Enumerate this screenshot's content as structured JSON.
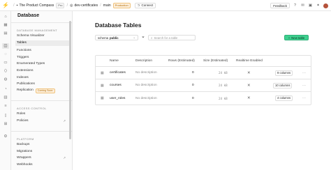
{
  "topbar": {
    "org": "The Product Compass",
    "org_badge": "Pro",
    "project": "dev-certificates",
    "branch": "main",
    "env_badge": "Production",
    "connect_label": "Connect",
    "feedback_label": "Feedback"
  },
  "sidebar": {
    "title": "Database",
    "sections": [
      {
        "label": "DATABASE MANAGEMENT",
        "items": [
          {
            "label": "Schema Visualizer"
          },
          {
            "label": "Tables"
          },
          {
            "label": "Functions"
          },
          {
            "label": "Triggers"
          },
          {
            "label": "Enumerated Types"
          },
          {
            "label": "Extensions"
          },
          {
            "label": "Indexes"
          },
          {
            "label": "Publications"
          },
          {
            "label": "Replication",
            "badge": "Coming Soon"
          }
        ]
      },
      {
        "label": "ACCESS CONTROL",
        "items": [
          {
            "label": "Roles"
          },
          {
            "label": "Policies"
          }
        ]
      },
      {
        "label": "PLATFORM",
        "items": [
          {
            "label": "Backups"
          },
          {
            "label": "Migrations"
          },
          {
            "label": "Wrappers"
          },
          {
            "label": "Webhooks"
          }
        ]
      }
    ]
  },
  "main": {
    "title": "Database Tables",
    "schema_prefix": "schema",
    "schema_value": "public",
    "search_placeholder": "Search for a table",
    "new_table_label": "New table",
    "columns": [
      "Name",
      "Description",
      "Rows (Estimated)",
      "Size (Estimated)",
      "Realtime Enabled"
    ],
    "rows": [
      {
        "name": "certificates",
        "description": "No description",
        "rows": "0",
        "size": "24 kB",
        "columns_label": "9 columns"
      },
      {
        "name": "courses",
        "description": "No description",
        "rows": "0",
        "size": "24 kB",
        "columns_label": "10 columns"
      },
      {
        "name": "user_roles",
        "description": "No description",
        "rows": "0",
        "size": "24 kB",
        "columns_label": "4 columns"
      }
    ]
  },
  "colors": {
    "brand": "#3ecf8e",
    "warning": "#b26b00"
  }
}
